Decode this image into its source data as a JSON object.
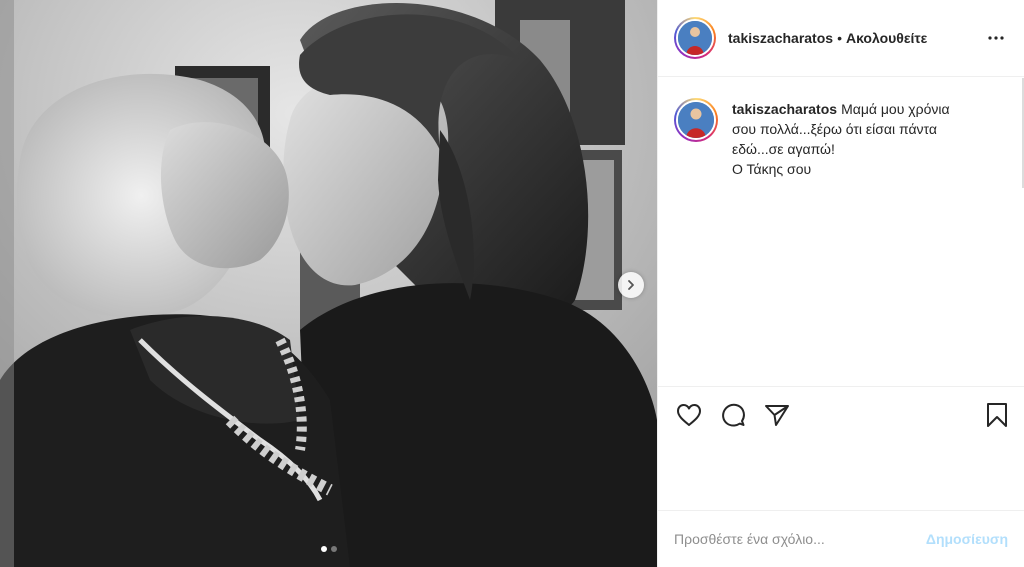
{
  "post": {
    "media": {
      "carousel_count": 2,
      "active_index": 0,
      "next_icon": "chevron-right-icon"
    },
    "header": {
      "username": "takiszacharatos",
      "separator": "•",
      "follow_label": "Ακολουθείτε",
      "more_icon": "more-horizontal-icon"
    },
    "caption": {
      "username": "takiszacharatos",
      "lines": [
        "Μαμά μου χρόνια",
        "σου πολλά...ξέρω ότι είσαι πάντα",
        "εδώ...σε αγαπώ!",
        "Ο Τάκης σου"
      ]
    },
    "actions": {
      "like_icon": "heart-icon",
      "comment_icon": "comment-icon",
      "share_icon": "send-icon",
      "save_icon": "bookmark-icon"
    },
    "add_comment": {
      "placeholder": "Προσθέστε ένα σχόλιο...",
      "post_label": "Δημοσίευση"
    }
  }
}
